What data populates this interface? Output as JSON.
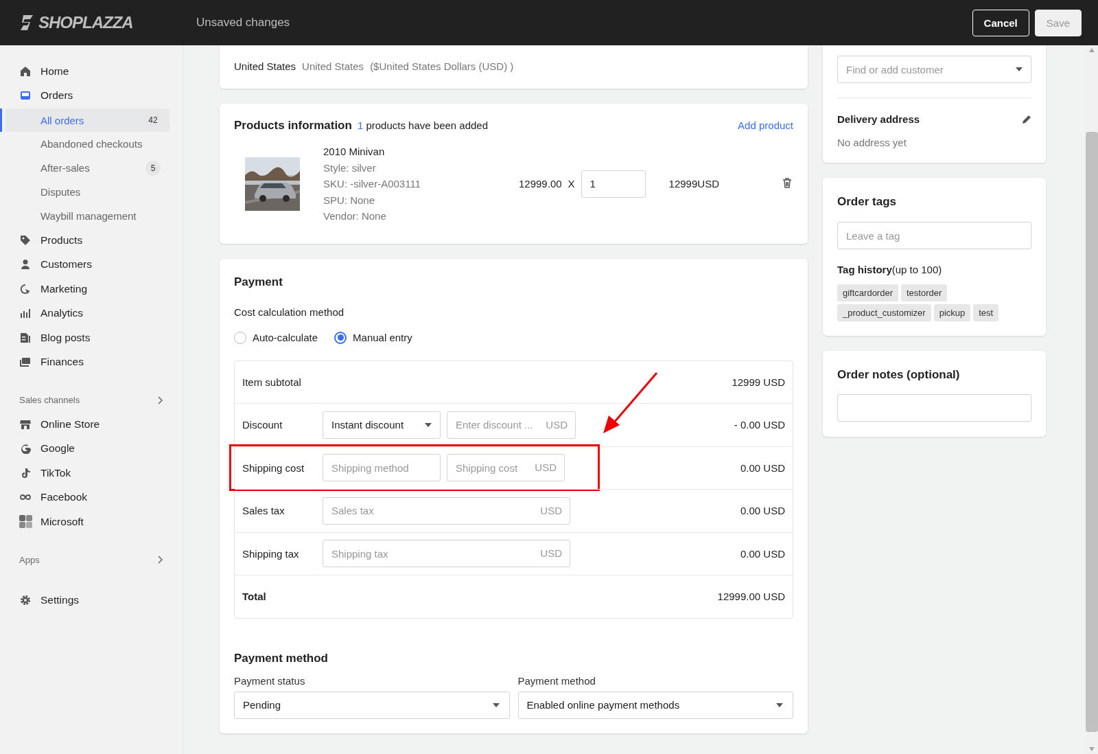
{
  "header": {
    "logo": "SHOPLAZZA",
    "title": "Unsaved changes",
    "buttons": [
      {
        "label": "Cancel",
        "disabled": false
      },
      {
        "label": "Save",
        "disabled": true
      }
    ]
  },
  "sidebar": {
    "groups": [
      {
        "items": [
          {
            "label": "Home"
          },
          {
            "label": "Orders",
            "children": [
              {
                "label": "All orders",
                "count": "42",
                "selected": true
              },
              {
                "label": "Abandoned checkouts",
                "selected": false
              },
              {
                "label": "After-sales",
                "count": "5",
                "selected": false
              },
              {
                "label": "Disputes",
                "selected": false
              },
              {
                "label": "Waybill management",
                "selected": false
              }
            ]
          },
          {
            "label": "Products"
          },
          {
            "label": "Customers"
          },
          {
            "label": "Marketing"
          },
          {
            "label": "Analytics"
          },
          {
            "label": "Blog posts"
          },
          {
            "label": "Finances"
          }
        ]
      },
      {
        "heading": "Sales channels",
        "items": [
          {
            "label": "Online Store"
          },
          {
            "label": "Google"
          },
          {
            "label": "TikTok"
          },
          {
            "label": "Facebook"
          },
          {
            "label": "Microsoft"
          }
        ]
      },
      {
        "heading": "Apps"
      },
      {
        "items": [
          {
            "label": "Settings"
          }
        ]
      }
    ]
  },
  "market": {
    "country": "United States",
    "market": "United States",
    "currency": "($United States Dollars (USD) )"
  },
  "products": {
    "title": "Products information",
    "added_count": "1",
    "added_text": "products have been added",
    "add_link": "Add product",
    "items": [
      {
        "image": {
          "kind": "picture"
        },
        "name": "2010 Minivan",
        "details": [
          "Style: silver",
          "SKU: -silver-A003111",
          "SPU: None",
          "Vendor: None"
        ],
        "price": "12999.00",
        "times": "X",
        "quantity": "1",
        "total": "12999USD"
      }
    ]
  },
  "payment": {
    "title": "Payment",
    "method_label": "Cost calculation method",
    "options": [
      {
        "label": "Auto-calculate",
        "selected": false
      },
      {
        "label": "Manual entry",
        "selected": true
      }
    ],
    "rows": [
      {
        "kind": "plain",
        "label": "Item subtotal",
        "amount": "12999 USD"
      },
      {
        "kind": "discount",
        "label": "Discount",
        "select": "Instant discount",
        "placeholder": "Enter discount ...",
        "unit": "USD",
        "amount": "- 0.00 USD"
      },
      {
        "kind": "shipping",
        "label": "Shipping cost",
        "method_placeholder": "Shipping method",
        "placeholder": "Shipping cost",
        "unit": "USD",
        "amount": "0.00 USD",
        "highlighted": true
      },
      {
        "kind": "wide",
        "label": "Sales tax",
        "placeholder": "Sales tax",
        "unit": "USD",
        "amount": "0.00 USD"
      },
      {
        "kind": "wide",
        "label": "Shipping tax",
        "placeholder": "Shipping tax",
        "unit": "USD",
        "amount": "0.00 USD"
      },
      {
        "kind": "total",
        "label": "Total",
        "amount": "12999.00 USD"
      }
    ]
  },
  "payment_method": {
    "title": "Payment method",
    "fields": [
      {
        "label": "Payment status",
        "value": "Pending"
      },
      {
        "label": "Payment method",
        "value": "Enabled online payment methods"
      }
    ]
  },
  "customer": {
    "placeholder": "Find or add customer"
  },
  "delivery": {
    "title": "Delivery address",
    "text": "No address yet"
  },
  "order_tags": {
    "title": "Order tags",
    "placeholder": "Leave a tag",
    "history_title": "Tag history",
    "history_note": "(up to 100)",
    "tags": [
      "giftcardorder",
      "testorder",
      "_product_customizer",
      "pickup",
      "test"
    ]
  },
  "order_notes": {
    "title": "Order notes (optional)"
  }
}
